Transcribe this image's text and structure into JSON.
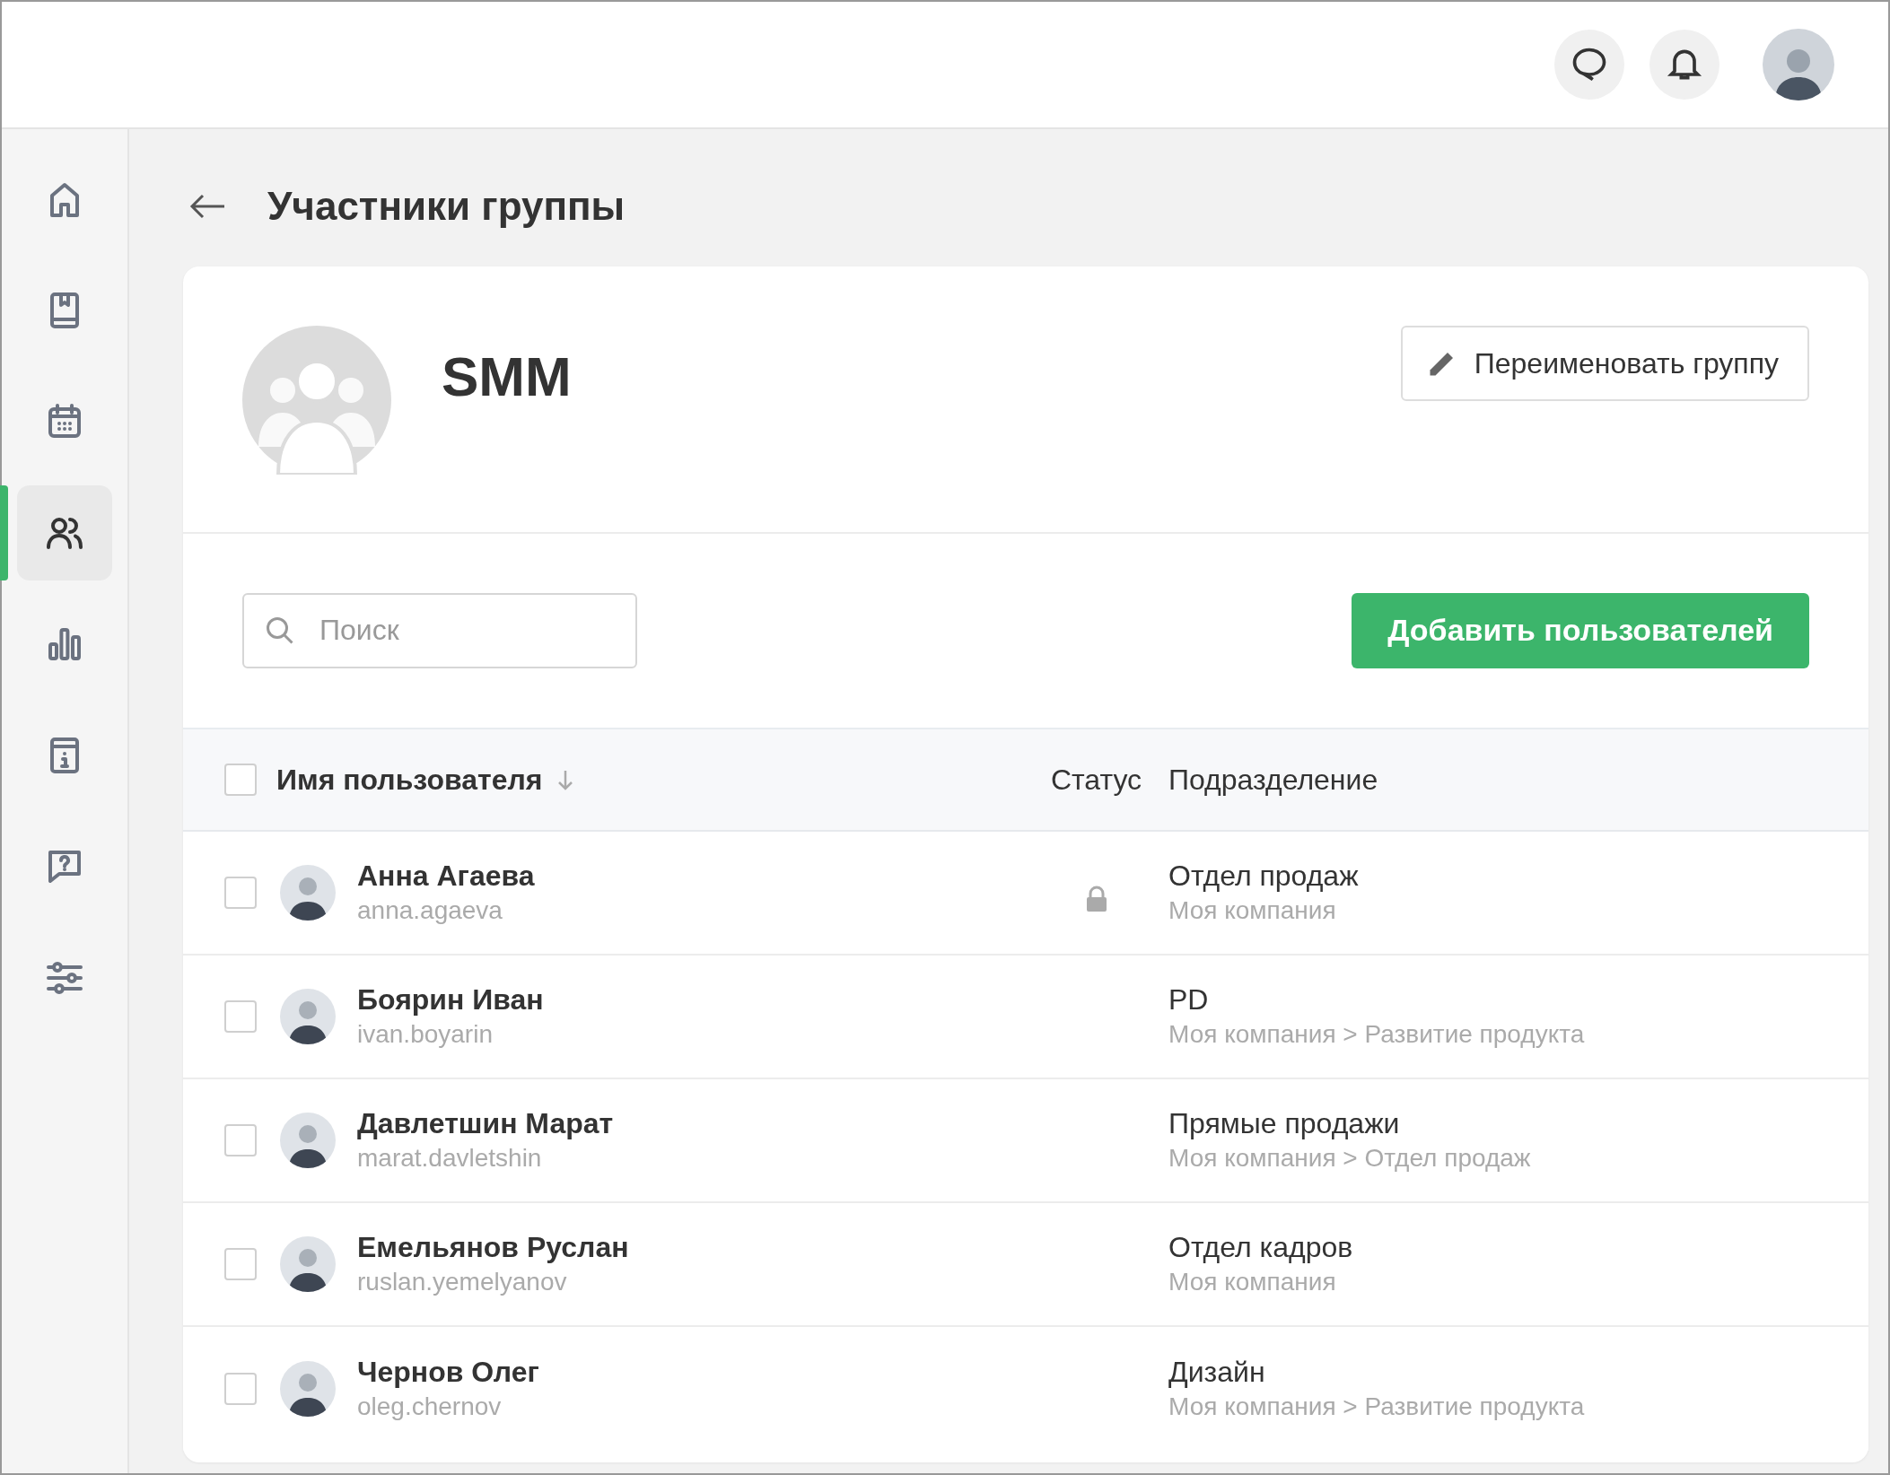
{
  "sidebar": {
    "items": [
      {
        "selected": false
      },
      {
        "selected": false
      },
      {
        "selected": false
      },
      {
        "selected": true
      },
      {
        "selected": false
      },
      {
        "selected": false
      },
      {
        "selected": false
      },
      {
        "selected": false
      }
    ]
  },
  "page": {
    "title": "Участники группы"
  },
  "group": {
    "name": "SMM",
    "rename_button": "Переименовать группу"
  },
  "search": {
    "placeholder": "Поиск"
  },
  "add_button": "Добавить пользователей",
  "table": {
    "select_all": {
      "checked": false
    },
    "columns": [
      {
        "label": "Имя пользователя",
        "sorted": true
      },
      {
        "label": "Статус",
        "sorted": false
      },
      {
        "label": "Подразделение",
        "sorted": false
      }
    ],
    "rows": [
      {
        "checked": false,
        "name": "Анна Агаева",
        "login": "anna.agaeva",
        "locked": true,
        "department": "Отдел продаж",
        "path": "Моя компания"
      },
      {
        "checked": false,
        "name": "Боярин Иван",
        "login": "ivan.boyarin",
        "locked": false,
        "department": "PD",
        "path": "Моя компания > Развитие продукта"
      },
      {
        "checked": false,
        "name": "Давлетшин Марат",
        "login": "marat.davletshin",
        "locked": false,
        "department": "Прямые продажи",
        "path": "Моя компания > Отдел продаж"
      },
      {
        "checked": false,
        "name": "Емельянов Руслан",
        "login": "ruslan.yemelyanov",
        "locked": false,
        "department": "Отдел кадров",
        "path": "Моя компания"
      },
      {
        "checked": false,
        "name": "Чернов Олег",
        "login": "oleg.chernov",
        "locked": false,
        "department": "Дизайн",
        "path": "Моя компания > Развитие продукта"
      }
    ]
  }
}
